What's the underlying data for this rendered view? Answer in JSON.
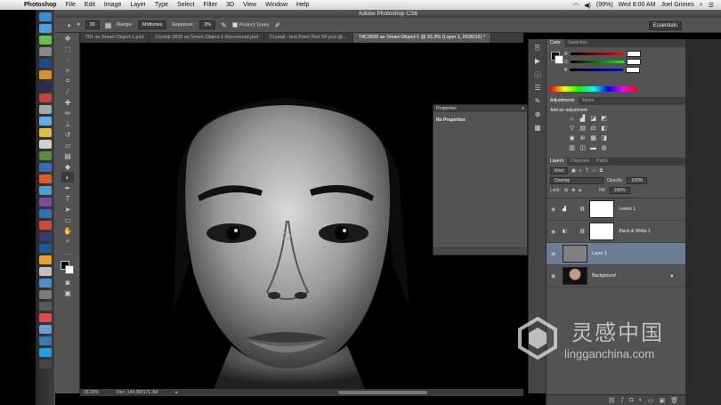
{
  "menubar": {
    "app_name": "Photoshop",
    "items": [
      "File",
      "Edit",
      "Image",
      "Layer",
      "Type",
      "Select",
      "Filter",
      "3D",
      "View",
      "Window",
      "Help"
    ],
    "battery": "(99%)",
    "clock": "Wed 8:00 AM",
    "user": "Joel Grimes"
  },
  "window_title": "Adobe Photoshop CS6",
  "options_bar": {
    "brush_size": "39",
    "range_label": "Range:",
    "range_value": "Midtones",
    "exposure_label": "Exposure:",
    "exposure_value": "3%",
    "protect_tones_label": "Protect Tones",
    "workspace": "Essentials"
  },
  "doc_tabs": [
    "701 as Smart Object-1.psd",
    "Crystal 2839 as Smart Object-1-Recovered.psd",
    "Crystal - test Point Port SF.psd @...",
    "T4C2839 as Smart Object-1 @ 33.3% (Layer 1, RGB/16) *"
  ],
  "status": {
    "zoom": "33.33%",
    "doc": "Doc: 144.3M/171.3M"
  },
  "properties_panel": {
    "title": "Properties",
    "body": "No Properties"
  },
  "color_panel": {
    "tabs": [
      "Color",
      "Swatches"
    ],
    "channels": [
      "R",
      "G",
      "B"
    ]
  },
  "adjustments_panel": {
    "tabs": [
      "Adjustments",
      "Styles"
    ],
    "title": "Add an adjustment"
  },
  "layers_panel": {
    "tabs": [
      "Layers",
      "Channels",
      "Paths"
    ],
    "filter": "Kind",
    "blend_mode": "Overlay",
    "opacity_label": "Opacity:",
    "opacity": "100%",
    "lock_label": "Lock:",
    "fill_label": "Fill:",
    "fill": "100%",
    "layers": [
      {
        "name": "Levels 1"
      },
      {
        "name": "Black & White 1"
      },
      {
        "name": "Layer 1"
      },
      {
        "name": "Background"
      }
    ]
  },
  "watermark": {
    "cn": "灵感中国",
    "url": "lingganchina.com"
  }
}
